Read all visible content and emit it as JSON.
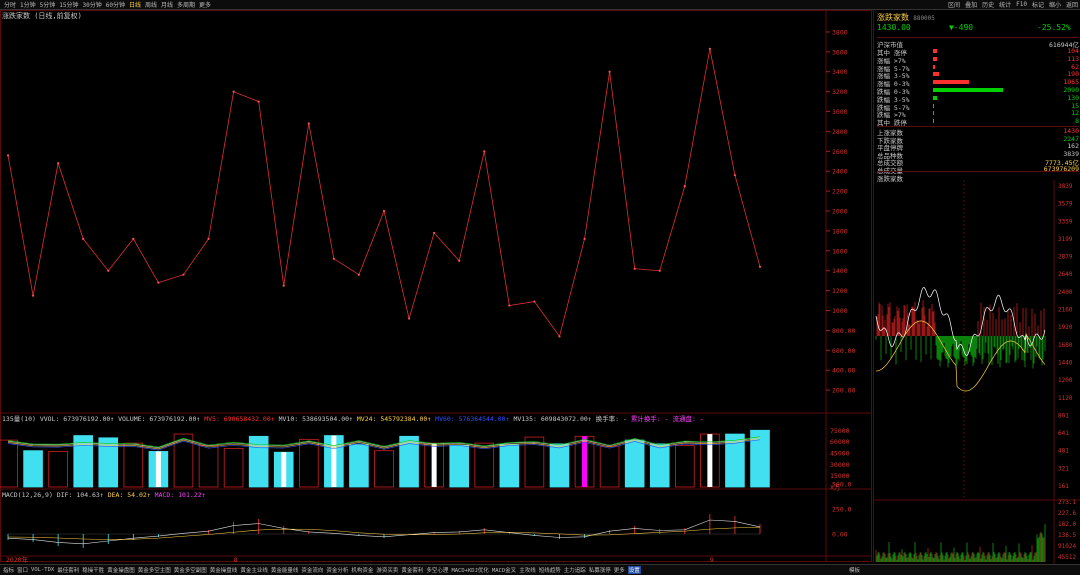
{
  "toolbar": {
    "periods": [
      "分时",
      "1分钟",
      "5分钟",
      "15分钟",
      "30分钟",
      "60分钟",
      "日线",
      "周线",
      "月线",
      "多周期",
      "更多"
    ],
    "active_period": "日线",
    "right_items": [
      "区间",
      "叠加",
      "历史",
      "统计",
      "F10",
      "标记",
      "缩小",
      "返回"
    ]
  },
  "main": {
    "title": "涨跌家数 (日线,前复权)",
    "y_ticks": [
      "3800",
      "3600",
      "3400",
      "3200",
      "3000",
      "2800",
      "2600",
      "2400",
      "2200",
      "2000",
      "1800",
      "1600",
      "1400",
      "1200",
      "1000",
      "800.00",
      "600.00",
      "400.00",
      "200.00"
    ],
    "x_labels": [
      "2020年",
      "8",
      "9"
    ]
  },
  "volume": {
    "header": {
      "name": "135量(10)",
      "vvol": "VVOL: 673976192.00↑",
      "volume": "VOLUME: 673976192.00↑",
      "mv5": "MV5: 690658432.00↑",
      "mv10": "MV10: 538693504.00↑",
      "mv24": "MV24: 545792384.00↑",
      "mv60": "MV60: 576364544.00↑",
      "mv135": "MV135: 609843072.00↑",
      "turnover": "换手率: -",
      "cum_turnover": "累计换手: -",
      "flow": "流通盘: -"
    },
    "y_ticks": [
      "75000",
      "60000",
      "45000",
      "30000",
      "15000",
      "X万"
    ]
  },
  "macd": {
    "header": {
      "name": "MACD(12,26,9)",
      "dif": "DIF: 104.63↑",
      "dea": "DEA: 54.02↑",
      "macd": "MACD: 101.22↑"
    },
    "y_ticks": [
      "500.0",
      "250.0",
      "0.00"
    ]
  },
  "chart_data": {
    "type": "line",
    "title": "涨跌家数 (日线,前复权)",
    "ylim": [
      0,
      3900
    ],
    "series": [
      {
        "name": "涨跌家数",
        "values": [
          2560,
          1150,
          2480,
          1720,
          1400,
          1720,
          1280,
          1360,
          1720,
          3200,
          3100,
          1250,
          2880,
          1520,
          1360,
          2000,
          920,
          1780,
          1500,
          2600,
          1050,
          1090,
          740,
          1720,
          3400,
          1420,
          1400,
          2250,
          3630,
          2360,
          1440
        ]
      }
    ],
    "volume_values": [
      62000,
      48000,
      47000,
      68000,
      65000,
      58000,
      47000,
      70000,
      55000,
      51000,
      67000,
      46000,
      63000,
      68000,
      56000,
      48000,
      67000,
      58000,
      55000,
      58000,
      56000,
      66000,
      57000,
      67000,
      54000,
      62000,
      57000,
      55000,
      70000,
      70000,
      75000
    ],
    "macd_values": [
      -60,
      -80,
      -120,
      -140,
      -100,
      -60,
      -30,
      10,
      40,
      120,
      150,
      80,
      30,
      10,
      -20,
      -40,
      -10,
      20,
      30,
      60,
      20,
      -20,
      -50,
      -40,
      40,
      80,
      50,
      60,
      200,
      180,
      101
    ]
  },
  "right": {
    "name": "涨跌家数",
    "code": "880005",
    "price": "1430.00",
    "change": "▼-490",
    "change_pct": "-25.52%",
    "market_value_label": "沪深市值",
    "market_value": "616944亿",
    "colors": {
      "up": "#ff3030",
      "down": "#00d000",
      "gold": "#ffd040"
    },
    "breakdown": [
      {
        "label": "其中 涨停",
        "value": "104",
        "dir": "up",
        "frac": 0.02
      },
      {
        "label": "涨幅 >7%",
        "value": "113",
        "dir": "up",
        "frac": 0.02
      },
      {
        "label": "涨幅 5-7%",
        "value": "62",
        "dir": "up",
        "frac": 0.01
      },
      {
        "label": "涨幅 3-5%",
        "value": "190",
        "dir": "up",
        "frac": 0.03
      },
      {
        "label": "涨幅 0-3%",
        "value": "1065",
        "dir": "up",
        "frac": 0.18
      },
      {
        "label": "跌幅 0-3%",
        "value": "2090",
        "dir": "down",
        "frac": 0.35
      },
      {
        "label": "跌幅 3-5%",
        "value": "130",
        "dir": "down",
        "frac": 0.02
      },
      {
        "label": "跌幅 5-7%",
        "value": "15",
        "dir": "down",
        "frac": 0.003
      },
      {
        "label": "跌幅 >7%",
        "value": "12",
        "dir": "down",
        "frac": 0.003
      },
      {
        "label": "其中 跌停",
        "value": "8",
        "dir": "down",
        "frac": 0.0
      }
    ],
    "summary": [
      {
        "label": "上涨家数",
        "value": "1430",
        "color": "#ff3030"
      },
      {
        "label": "下跌家数",
        "value": "2247",
        "color": "#00d000"
      },
      {
        "label": "平盘停牌",
        "value": "162",
        "color": "#c8c8c8"
      },
      {
        "label": "总品种数",
        "value": "3839",
        "color": "#c8c8c8"
      },
      {
        "label": "总成交额",
        "value": "7773.45亿",
        "color": "#ffd040"
      },
      {
        "label": "总成交量",
        "value": "673976209",
        "color": "#ffd040"
      }
    ],
    "mini_title": "涨跌家数",
    "mini_ticks_right": [
      "3839",
      "3579",
      "3359",
      "3199",
      "2879",
      "2640",
      "2400",
      "2160",
      "1920",
      "1680",
      "1440",
      "1200",
      "1120",
      "801",
      "641",
      "481",
      "321",
      "161"
    ],
    "mini_bottom_ticks": [
      "273.1",
      "227.6",
      "182.0",
      "136.5",
      "91024",
      "45512"
    ]
  },
  "bottom": {
    "tabs": [
      "指标",
      "窗口",
      "VOL-TDX",
      "最佳套利",
      "稳操干胜",
      "黄金操盘图",
      "黄金多空主图",
      "黄金多空副图",
      "黄金操盘线",
      "黄金主业线",
      "黄金能量线",
      "资金流向",
      "资金分析",
      "机构资金",
      "游资买卖",
      "黄金套利",
      "多空心理",
      "MACD+KDJ优化",
      "MACD金叉",
      "主攻线",
      "短线趋势",
      "主力追踪",
      "私募涨停",
      "更多",
      "设置"
    ],
    "right_tab": "模板"
  }
}
